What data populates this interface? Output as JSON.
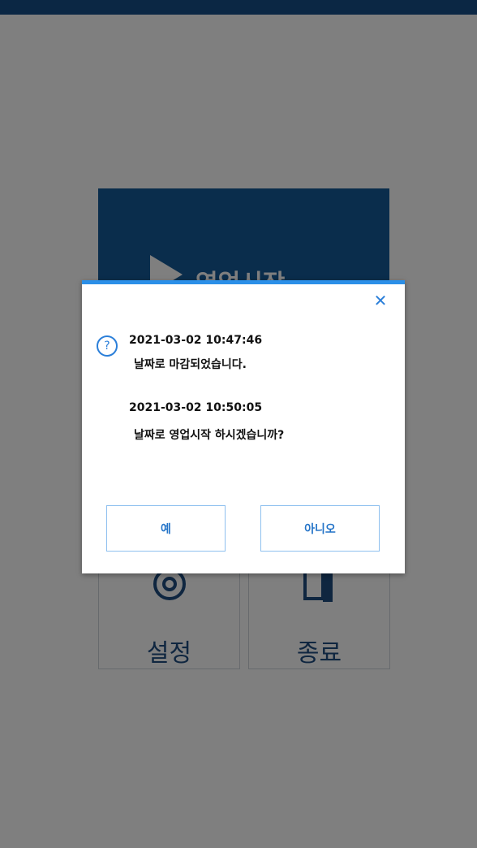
{
  "app": {
    "start_tile_label": "영업시작",
    "settings_tile_label": "설정",
    "exit_tile_label": "종료"
  },
  "dialog": {
    "close_icon": "close-icon",
    "question_icon": "question-icon",
    "line1": "2021-03-02 10:47:46",
    "line2": "날짜로 마감되었습니다.",
    "line3": "2021-03-02 10:50:05",
    "line4": "날짜로 영업시작 하시겠습니까?",
    "yes_label": "예",
    "no_label": "아니오"
  },
  "colors": {
    "brand_blue": "#155a99",
    "accent_blue": "#2b8fe8",
    "overlay": "rgba(0,0,0,0.5)"
  }
}
